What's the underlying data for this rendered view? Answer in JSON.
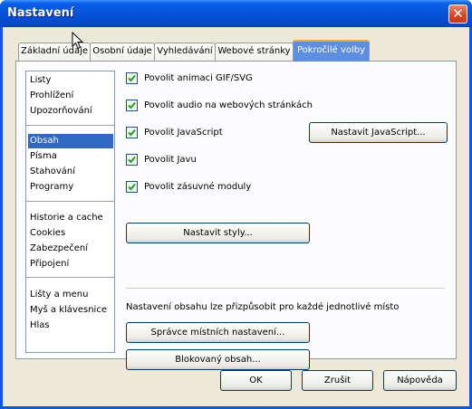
{
  "window": {
    "title": "Nastavení"
  },
  "tabs": [
    {
      "label": "Základní údaje"
    },
    {
      "label": "Osobní údaje"
    },
    {
      "label": "Vyhledávání"
    },
    {
      "label": "Webové stránky"
    },
    {
      "label": "Pokročilé volby",
      "active": true
    }
  ],
  "sidebar": {
    "groups": [
      [
        "Listy",
        "Prohlížení",
        "Upozorňování"
      ],
      [
        "Obsah",
        "Písma",
        "Stahování",
        "Programy"
      ],
      [
        "Historie a cache",
        "Cookies",
        "Zabezpečení",
        "Připojení"
      ],
      [
        "Lišty a menu",
        "Myš a klávesnice",
        "Hlas"
      ]
    ],
    "selected": "Obsah"
  },
  "content": {
    "checkboxes": [
      {
        "label": "Povolit animaci GIF/SVG",
        "checked": true
      },
      {
        "label": "Povolit audio na webových stránkách",
        "checked": true
      },
      {
        "label": "Povolit JavaScript",
        "checked": true
      },
      {
        "label": "Povolit Javu",
        "checked": true
      },
      {
        "label": "Povolit zásuvné moduly",
        "checked": true
      }
    ],
    "js_button": "Nastavit JavaScript...",
    "styles_button": "Nastavit styly...",
    "description": "Nastavení obsahu lze přizpůsobit pro každé jednotlivé místo",
    "site_prefs_button": "Správce místních nastavení...",
    "blocked_button": "Blokovaný obsah..."
  },
  "footer": {
    "ok": "OK",
    "cancel": "Zrušit",
    "help": "Nápověda"
  }
}
